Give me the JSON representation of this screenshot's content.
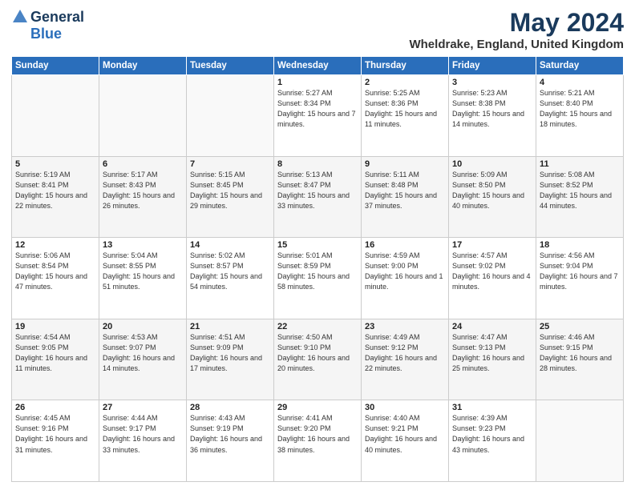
{
  "header": {
    "logo_general": "General",
    "logo_blue": "Blue",
    "month_title": "May 2024",
    "location": "Wheldrake, England, United Kingdom"
  },
  "weekdays": [
    "Sunday",
    "Monday",
    "Tuesday",
    "Wednesday",
    "Thursday",
    "Friday",
    "Saturday"
  ],
  "weeks": [
    [
      {
        "day": "",
        "sunrise": "",
        "sunset": "",
        "daylight": ""
      },
      {
        "day": "",
        "sunrise": "",
        "sunset": "",
        "daylight": ""
      },
      {
        "day": "",
        "sunrise": "",
        "sunset": "",
        "daylight": ""
      },
      {
        "day": "1",
        "sunrise": "Sunrise: 5:27 AM",
        "sunset": "Sunset: 8:34 PM",
        "daylight": "Daylight: 15 hours and 7 minutes."
      },
      {
        "day": "2",
        "sunrise": "Sunrise: 5:25 AM",
        "sunset": "Sunset: 8:36 PM",
        "daylight": "Daylight: 15 hours and 11 minutes."
      },
      {
        "day": "3",
        "sunrise": "Sunrise: 5:23 AM",
        "sunset": "Sunset: 8:38 PM",
        "daylight": "Daylight: 15 hours and 14 minutes."
      },
      {
        "day": "4",
        "sunrise": "Sunrise: 5:21 AM",
        "sunset": "Sunset: 8:40 PM",
        "daylight": "Daylight: 15 hours and 18 minutes."
      }
    ],
    [
      {
        "day": "5",
        "sunrise": "Sunrise: 5:19 AM",
        "sunset": "Sunset: 8:41 PM",
        "daylight": "Daylight: 15 hours and 22 minutes."
      },
      {
        "day": "6",
        "sunrise": "Sunrise: 5:17 AM",
        "sunset": "Sunset: 8:43 PM",
        "daylight": "Daylight: 15 hours and 26 minutes."
      },
      {
        "day": "7",
        "sunrise": "Sunrise: 5:15 AM",
        "sunset": "Sunset: 8:45 PM",
        "daylight": "Daylight: 15 hours and 29 minutes."
      },
      {
        "day": "8",
        "sunrise": "Sunrise: 5:13 AM",
        "sunset": "Sunset: 8:47 PM",
        "daylight": "Daylight: 15 hours and 33 minutes."
      },
      {
        "day": "9",
        "sunrise": "Sunrise: 5:11 AM",
        "sunset": "Sunset: 8:48 PM",
        "daylight": "Daylight: 15 hours and 37 minutes."
      },
      {
        "day": "10",
        "sunrise": "Sunrise: 5:09 AM",
        "sunset": "Sunset: 8:50 PM",
        "daylight": "Daylight: 15 hours and 40 minutes."
      },
      {
        "day": "11",
        "sunrise": "Sunrise: 5:08 AM",
        "sunset": "Sunset: 8:52 PM",
        "daylight": "Daylight: 15 hours and 44 minutes."
      }
    ],
    [
      {
        "day": "12",
        "sunrise": "Sunrise: 5:06 AM",
        "sunset": "Sunset: 8:54 PM",
        "daylight": "Daylight: 15 hours and 47 minutes."
      },
      {
        "day": "13",
        "sunrise": "Sunrise: 5:04 AM",
        "sunset": "Sunset: 8:55 PM",
        "daylight": "Daylight: 15 hours and 51 minutes."
      },
      {
        "day": "14",
        "sunrise": "Sunrise: 5:02 AM",
        "sunset": "Sunset: 8:57 PM",
        "daylight": "Daylight: 15 hours and 54 minutes."
      },
      {
        "day": "15",
        "sunrise": "Sunrise: 5:01 AM",
        "sunset": "Sunset: 8:59 PM",
        "daylight": "Daylight: 15 hours and 58 minutes."
      },
      {
        "day": "16",
        "sunrise": "Sunrise: 4:59 AM",
        "sunset": "Sunset: 9:00 PM",
        "daylight": "Daylight: 16 hours and 1 minute."
      },
      {
        "day": "17",
        "sunrise": "Sunrise: 4:57 AM",
        "sunset": "Sunset: 9:02 PM",
        "daylight": "Daylight: 16 hours and 4 minutes."
      },
      {
        "day": "18",
        "sunrise": "Sunrise: 4:56 AM",
        "sunset": "Sunset: 9:04 PM",
        "daylight": "Daylight: 16 hours and 7 minutes."
      }
    ],
    [
      {
        "day": "19",
        "sunrise": "Sunrise: 4:54 AM",
        "sunset": "Sunset: 9:05 PM",
        "daylight": "Daylight: 16 hours and 11 minutes."
      },
      {
        "day": "20",
        "sunrise": "Sunrise: 4:53 AM",
        "sunset": "Sunset: 9:07 PM",
        "daylight": "Daylight: 16 hours and 14 minutes."
      },
      {
        "day": "21",
        "sunrise": "Sunrise: 4:51 AM",
        "sunset": "Sunset: 9:09 PM",
        "daylight": "Daylight: 16 hours and 17 minutes."
      },
      {
        "day": "22",
        "sunrise": "Sunrise: 4:50 AM",
        "sunset": "Sunset: 9:10 PM",
        "daylight": "Daylight: 16 hours and 20 minutes."
      },
      {
        "day": "23",
        "sunrise": "Sunrise: 4:49 AM",
        "sunset": "Sunset: 9:12 PM",
        "daylight": "Daylight: 16 hours and 22 minutes."
      },
      {
        "day": "24",
        "sunrise": "Sunrise: 4:47 AM",
        "sunset": "Sunset: 9:13 PM",
        "daylight": "Daylight: 16 hours and 25 minutes."
      },
      {
        "day": "25",
        "sunrise": "Sunrise: 4:46 AM",
        "sunset": "Sunset: 9:15 PM",
        "daylight": "Daylight: 16 hours and 28 minutes."
      }
    ],
    [
      {
        "day": "26",
        "sunrise": "Sunrise: 4:45 AM",
        "sunset": "Sunset: 9:16 PM",
        "daylight": "Daylight: 16 hours and 31 minutes."
      },
      {
        "day": "27",
        "sunrise": "Sunrise: 4:44 AM",
        "sunset": "Sunset: 9:17 PM",
        "daylight": "Daylight: 16 hours and 33 minutes."
      },
      {
        "day": "28",
        "sunrise": "Sunrise: 4:43 AM",
        "sunset": "Sunset: 9:19 PM",
        "daylight": "Daylight: 16 hours and 36 minutes."
      },
      {
        "day": "29",
        "sunrise": "Sunrise: 4:41 AM",
        "sunset": "Sunset: 9:20 PM",
        "daylight": "Daylight: 16 hours and 38 minutes."
      },
      {
        "day": "30",
        "sunrise": "Sunrise: 4:40 AM",
        "sunset": "Sunset: 9:21 PM",
        "daylight": "Daylight: 16 hours and 40 minutes."
      },
      {
        "day": "31",
        "sunrise": "Sunrise: 4:39 AM",
        "sunset": "Sunset: 9:23 PM",
        "daylight": "Daylight: 16 hours and 43 minutes."
      },
      {
        "day": "",
        "sunrise": "",
        "sunset": "",
        "daylight": ""
      }
    ]
  ]
}
